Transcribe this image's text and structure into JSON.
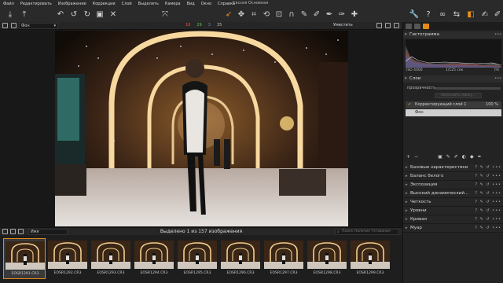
{
  "menu": [
    "Файл",
    "Редактировать",
    "Изображение",
    "Коррекции",
    "Слой",
    "Выделить",
    "Камера",
    "Вид",
    "Окно",
    "Справка"
  ],
  "session_title": "Сессия Основная",
  "viewer": {
    "view_mode": "Фон",
    "counters": {
      "red": "18",
      "green": "29",
      "blue": "3",
      "gray": "35"
    },
    "zoom_label": "Уместить"
  },
  "browser": {
    "sort_label": "Имя",
    "selected_text": "Выделено 1 из 157 изображения",
    "search_placeholder": "Поиск Наличие Тэгования"
  },
  "thumbnails": [
    {
      "name": "EOSR1291.CR3",
      "selected": true
    },
    {
      "name": "EOSR1292.CR3",
      "selected": false
    },
    {
      "name": "EOSR1293.CR3",
      "selected": false
    },
    {
      "name": "EOSR1294.CR3",
      "selected": false
    },
    {
      "name": "EOSR1295.CR3",
      "selected": false
    },
    {
      "name": "EOSR1296.CR3",
      "selected": false
    },
    {
      "name": "EOSR1297.CR3",
      "selected": false
    },
    {
      "name": "EOSR1298.CR3",
      "selected": false
    },
    {
      "name": "EOSR1299.CR3",
      "selected": false
    }
  ],
  "panel": {
    "histogram_title": "Гистограмма",
    "iso": "ISO 4000",
    "shutter": "1/125 сек",
    "aperture": "f/4",
    "layers_title": "Слои",
    "opacity_label": "прозрачность",
    "disabled_button": "Заполнить маску...",
    "layers": [
      {
        "name": "Корректирующий слой 1",
        "percent": "100 %"
      },
      {
        "name": "Фон"
      }
    ],
    "tools": [
      "Базовые характеристики",
      "Баланс белого",
      "Экспозиция",
      "Высокий динамический...",
      "Четкость",
      "Уровни",
      "Кривая",
      "Муар"
    ]
  },
  "colors": {
    "accent": "#e58a19",
    "panel_bg": "#232323",
    "viewer_bg": "#181818"
  }
}
